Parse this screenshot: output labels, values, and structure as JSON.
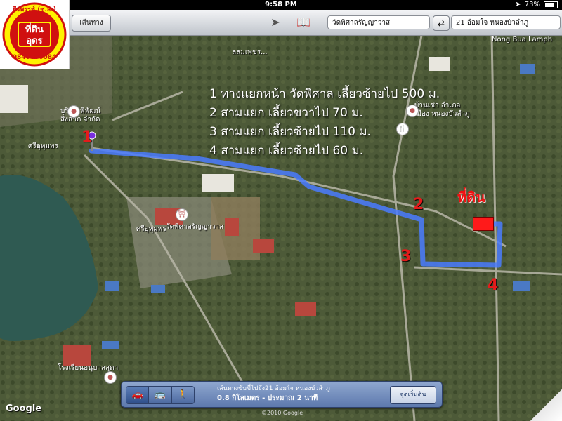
{
  "status_bar": {
    "carrier": "",
    "time": "9:58 PM",
    "battery": "73%",
    "battery_level": 0.73
  },
  "toolbar": {
    "directions_label": "เส้นทาง",
    "start_field": "วัดพิศาลรัญญาวาส",
    "end_field": "21 อ้อมใจ หนองบัวลำภู"
  },
  "logo": {
    "line1": "ธีรพรรช์ (ซ.ส.)",
    "line2": "ที่ดิน",
    "line3": "อุดร",
    "phone": "0840000084"
  },
  "instructions": [
    "1 ทางแยกหน้า วัดพิศาล เลี้ยวซ้ายไป 500 ม.",
    "2 สามแยก เลี้ยวขวาไป 70 ม.",
    "3 สามแยก เลี้ยวซ้ายไป 110 ม.",
    "4 สามแยก เลี้ยวซ้ายไป 60 ม."
  ],
  "markers": {
    "m1": "1",
    "m2": "2",
    "m3": "3",
    "m4": "4",
    "destination": "ที่ดิน"
  },
  "places": {
    "temple": "วัดพิศาลรัญญาวาส",
    "company": "บริษัท พิพัฒน์",
    "company2": "สิ่งลาภ จำกัด",
    "school": "โรงเรียนอนุบาลสุดา",
    "area": "บ้านเช่า อำเภอ",
    "area2": "เมือง หนองบัวลำภู",
    "road1": "ศรีอุทุมพร",
    "road2": "ศรีอุทุมพร",
    "poi_top": "Nong Bua Lamph",
    "road_top": "ลลมเพชร..."
  },
  "route_panel": {
    "destination_text": "เส้นทางขับขี่ไปยัง21 อ้อมใจ หนองบัวลำภู",
    "summary": "0.8 กิโลเมตร - ประมาณ 2 นาที",
    "start_button": "จุดเริ่มต้น",
    "modes": [
      "🚗",
      "🚌",
      "🚶"
    ]
  },
  "attribution": {
    "google": "Google",
    "copyright": "©2010 Google"
  },
  "colors": {
    "route": "#4a7bff",
    "marker": "#e41b1b",
    "destination": "#ff1a1a"
  }
}
